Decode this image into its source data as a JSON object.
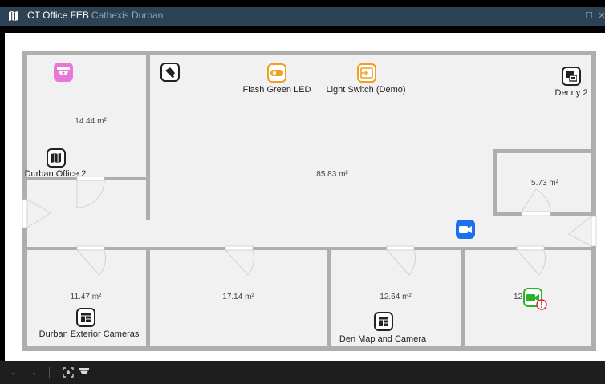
{
  "window": {
    "title": "CT Office FEB",
    "subtitle": "Cathexis Durban",
    "maximize_glyph": "☐",
    "close_glyph": "✕"
  },
  "rooms": {
    "top_left_area": "14.44 m²",
    "main_area": "85.83 m²",
    "small_right_area": "5.73 m²",
    "bottom_1_area": "11.47 m²",
    "bottom_2_area": "17.14 m²",
    "bottom_3_area": "12.64 m²",
    "bottom_4_area": "12."
  },
  "devices": {
    "flash_green_led": "Flash Green LED",
    "light_switch": "Light Switch (Demo)",
    "denny2": "Denny 2",
    "durban_office2": "Durban Office 2",
    "durban_exterior": "Durban Exterior Cameras",
    "den_map": "Den Map and Camera"
  },
  "icons": {
    "dome_camera": "dome-camera-icon",
    "speaker": "speaker-icon",
    "led": "led-icon",
    "switch": "switch-input-icon",
    "monitor": "multi-monitor-icon",
    "map": "map-icon",
    "camera": "video-camera-icon",
    "layout": "grid-layout-icon",
    "error": "error-badge-icon"
  },
  "colors": {
    "dome_pink": "#e878d8",
    "orange": "#f0a020",
    "blue_camera": "#1e6ff0",
    "green_camera": "#2bb32b",
    "error_red": "#e02020"
  },
  "toolbar": {
    "back": "←",
    "forward": "→"
  }
}
